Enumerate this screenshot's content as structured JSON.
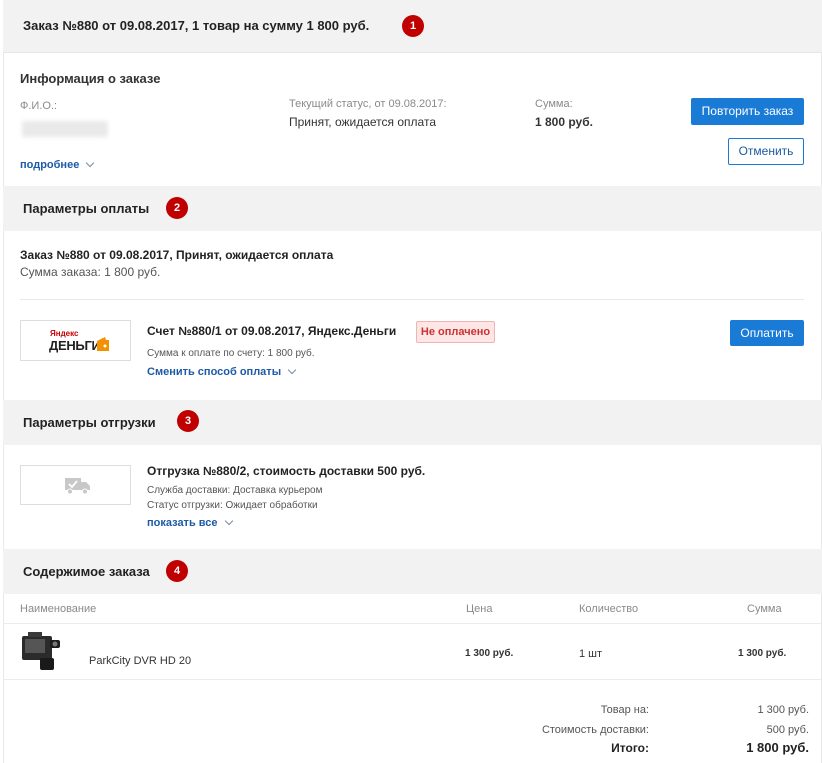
{
  "header": {
    "title": "Заказ №880 от 09.08.2017, 1 товар на сумму 1 800 руб.",
    "badge": "1"
  },
  "info": {
    "title": "Информация о заказе",
    "fio_label": "Ф.И.О.:",
    "status_label": "Текущий статус, от 09.08.2017:",
    "status_value": "Принят, ожидается оплата",
    "sum_label": "Сумма:",
    "sum_value": "1 800 руб.",
    "more_link": "подробнее",
    "repeat_button": "Повторить заказ",
    "cancel_button": "Отменить"
  },
  "payment": {
    "section_title": "Параметры оплаты",
    "badge": "2",
    "order_line": "Заказ №880 от 09.08.2017, Принят, ожидается оплата",
    "order_sum": "Сумма заказа: 1 800 руб.",
    "logo_top": "Яндекс",
    "logo_bottom": "ДЕНЬГИ",
    "invoice_title": "Счет №880/1 от 09.08.2017, Яндекс.Деньги",
    "unpaid_badge": "Не оплачено",
    "invoice_sum": "Сумма к оплате по счету: 1 800 руб.",
    "change_method": "Сменить способ оплаты",
    "pay_button": "Оплатить"
  },
  "shipment": {
    "section_title": "Параметры отгрузки",
    "badge": "3",
    "title": "Отгрузка №880/2, стоимость доставки 500 руб.",
    "service": "Служба доставки: Доставка курьером",
    "status": "Статус отгрузки: Ожидает обработки",
    "show_all": "показать все"
  },
  "contents": {
    "section_title": "Содержимое заказа",
    "badge": "4",
    "headers": {
      "name": "Наименование",
      "price": "Цена",
      "qty": "Количество",
      "sum": "Сумма"
    },
    "rows": [
      {
        "name": "ParkCity DVR HD 20",
        "price": "1 300 руб.",
        "qty": "1  шт",
        "sum": "1 300 руб."
      }
    ]
  },
  "totals": {
    "goods_label": "Товар на:",
    "goods_value": "1 300 руб.",
    "delivery_label": "Стоимость доставки:",
    "delivery_value": "500 руб.",
    "total_label": "Итого:",
    "total_value": "1 800 руб."
  },
  "colors": {
    "accent": "#1a7bd7",
    "step_badge": "#c00000",
    "band": "#f2f2f2",
    "unpaid": "#c33333"
  }
}
